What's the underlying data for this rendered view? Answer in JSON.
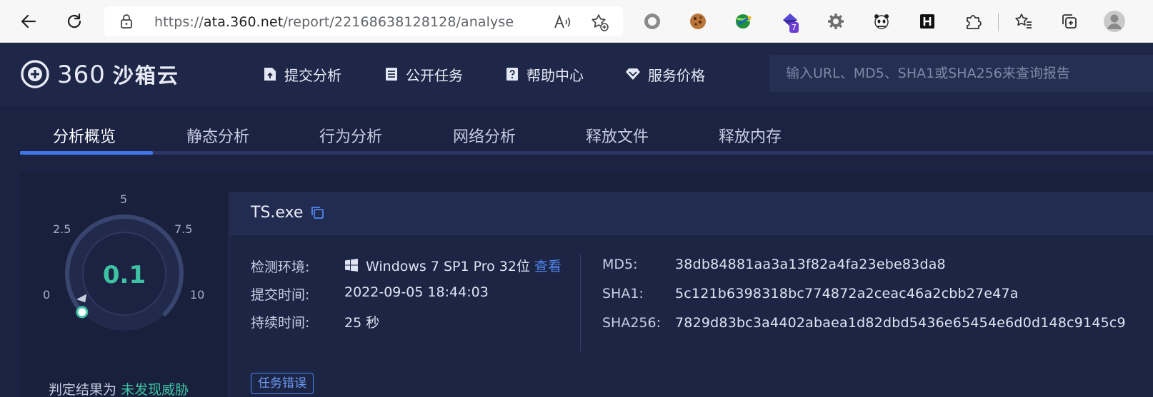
{
  "browser": {
    "url_prefix": "https://",
    "url_host": "ata.360.net",
    "url_path": "/report/22168638128128/analyse",
    "extension_badge": "7",
    "icons": [
      "back-icon",
      "refresh-icon",
      "lock-icon",
      "read-aloud-icon",
      "favorite-add-icon",
      "circle-extension-icon",
      "cookie-extension-icon",
      "globe-extension-icon",
      "purple-gem-extension-icon",
      "gear-extension-icon",
      "panda-extension-icon",
      "h-extension-icon",
      "puzzle-extension-icon",
      "favorites-icon",
      "collections-icon",
      "profile-avatar-icon"
    ]
  },
  "header": {
    "logo_text": "360",
    "logo_cn": "沙箱云",
    "nav": [
      {
        "label": "提交分析",
        "icon": "submit-icon"
      },
      {
        "label": "公开任务",
        "icon": "list-icon"
      },
      {
        "label": "帮助中心",
        "icon": "help-icon"
      },
      {
        "label": "服务价格",
        "icon": "diamond-icon"
      }
    ],
    "search_placeholder": "输入URL、MD5、SHA1或SHA256来查询报告"
  },
  "tabs": [
    "分析概览",
    "静态分析",
    "行为分析",
    "网络分析",
    "释放文件",
    "释放内存"
  ],
  "active_tab": "分析概览",
  "gauge": {
    "ticks": [
      "0",
      "2.5",
      "5",
      "7.5",
      "10"
    ],
    "score": "0.1",
    "min": 0,
    "max": 10,
    "score_color": "#3ec2a4"
  },
  "verdict": {
    "prefix": "判定结果为",
    "result": "未发现威胁"
  },
  "file": {
    "name": "TS.exe",
    "env_label": "检测环境:",
    "env_value": "Windows 7 SP1 Pro 32位",
    "env_link": "查看",
    "submit_label": "提交时间:",
    "submit_value": "2022-09-05 18:44:03",
    "duration_label": "持续时间:",
    "duration_value": "25 秒",
    "md5_label": "MD5:",
    "md5_value": "38db84881aa3a13f82a4fa23ebe83da8",
    "sha1_label": "SHA1:",
    "sha1_value": "5c121b6398318bc774872a2ceac46a2cbb27e47a",
    "sha256_label": "SHA256:",
    "sha256_value": "7829d83bc3a4402abaea1d82dbd5436e65454e6d0d148c9145c9",
    "status_tag": "任务错误"
  },
  "colors": {
    "page_bg": "#1b2242",
    "header_bg": "#1e2747",
    "accent_blue": "#3f78e6",
    "link": "#4f86f0",
    "score_green": "#3ec2a4"
  }
}
